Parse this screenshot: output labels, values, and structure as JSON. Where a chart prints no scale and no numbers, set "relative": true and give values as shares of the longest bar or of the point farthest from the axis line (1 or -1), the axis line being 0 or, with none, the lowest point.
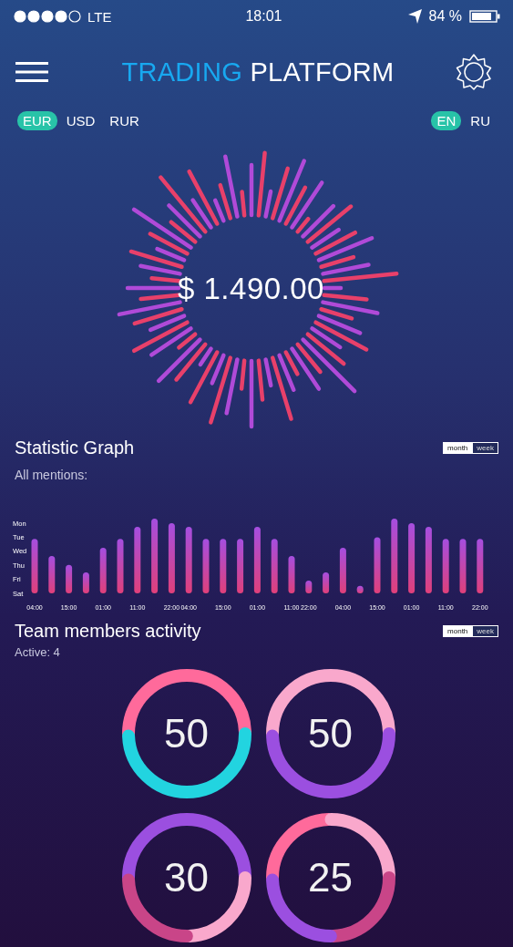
{
  "status_bar": {
    "carrier": "LTE",
    "time": "18:01",
    "battery": "84 %"
  },
  "header": {
    "title_accent": "TRADING",
    "title_rest": "PLATFORM"
  },
  "currencies": [
    {
      "label": "EUR",
      "selected": true
    },
    {
      "label": "USD",
      "selected": false
    },
    {
      "label": "RUR",
      "selected": false
    }
  ],
  "languages": [
    {
      "label": "EN",
      "selected": true
    },
    {
      "label": "RU",
      "selected": false
    }
  ],
  "balance": {
    "amount": "$ 1.490.00"
  },
  "statistic": {
    "title": "Statistic Graph",
    "subtitle": "All mentions:",
    "periods": [
      {
        "label": "month",
        "selected": true
      },
      {
        "label": "week",
        "selected": false
      }
    ],
    "day_labels": [
      "Mon",
      "Tue",
      "Wed",
      "Thu",
      "Fri",
      "Sat"
    ],
    "chart_data": {
      "type": "bar",
      "relative": true,
      "categories": [
        "04:00",
        null,
        "15:00",
        null,
        "01:00",
        null,
        "11:00",
        null,
        "22:00",
        "04:00",
        null,
        "15:00",
        null,
        "01:00",
        null,
        "11:00",
        "22:00",
        null,
        "04:00",
        null,
        "15:00",
        null,
        "01:00",
        null,
        "11:00",
        null,
        "22:00"
      ],
      "series": [
        {
          "color": "#e0407a",
          "values": [
            0.73,
            0.5,
            0.38,
            0.28,
            0.61,
            0.73,
            0.89,
            1,
            0.94,
            0.89,
            0.73,
            0.73,
            0.73,
            0.89,
            0.73,
            0.5,
            0.17,
            0.28,
            0.61,
            0.1,
            0.75,
            1,
            0.94,
            0.89,
            0.73,
            0.73,
            0.73
          ]
        }
      ]
    }
  },
  "team": {
    "title": "Team members activity",
    "subtitle": "Active: 4",
    "periods": [
      {
        "label": "month",
        "selected": true
      },
      {
        "label": "week",
        "selected": false
      }
    ],
    "rings": [
      {
        "value": "50",
        "segments": [
          {
            "color": "#ff6a9b"
          },
          {
            "color": "#22d4e0"
          }
        ]
      },
      {
        "value": "50",
        "segments": [
          {
            "color": "#f9a8cc"
          },
          {
            "color": "#9b4fe0"
          }
        ]
      },
      {
        "value": "30",
        "segments": [
          {
            "color": "#9b4fe0"
          },
          {
            "color": "#9b4fe0"
          },
          {
            "color": "#f9a8cc"
          },
          {
            "color": "#c94588"
          }
        ]
      },
      {
        "value": "25",
        "segments": [
          {
            "color": "#ff6a9b"
          },
          {
            "color": "#f9a8cc"
          },
          {
            "color": "#c94588"
          },
          {
            "color": "#9b4fe0"
          }
        ]
      }
    ]
  }
}
